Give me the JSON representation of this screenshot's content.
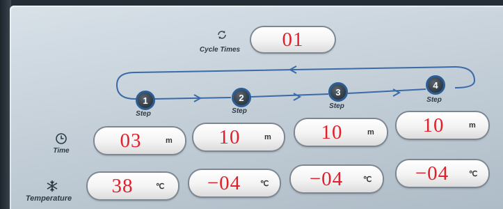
{
  "cycle": {
    "label": "Cycle Times",
    "value": "01"
  },
  "steps": [
    {
      "number": "1",
      "label": "Step",
      "time": "03",
      "time_unit": "m",
      "temp": "38",
      "temp_unit": "℃"
    },
    {
      "number": "2",
      "label": "Step",
      "time": "10",
      "time_unit": "m",
      "temp": "−04",
      "temp_unit": "℃"
    },
    {
      "number": "3",
      "label": "Step",
      "time": "10",
      "time_unit": "m",
      "temp": "−04",
      "temp_unit": "℃"
    },
    {
      "number": "4",
      "label": "Step",
      "time": "10",
      "time_unit": "m",
      "temp": "−04",
      "temp_unit": "℃"
    }
  ],
  "row_labels": {
    "time": "Time",
    "temperature": "Temperature"
  },
  "icons": {
    "cycle": "refresh-icon",
    "time": "clock-icon",
    "temperature": "snowflake-icon"
  },
  "colors": {
    "value_text": "#e0202a",
    "step_ring": "#2c5d95",
    "flow_line": "#3a6aa8"
  }
}
